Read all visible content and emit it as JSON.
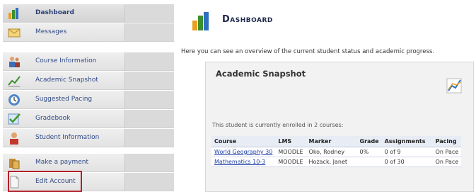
{
  "sidebar": {
    "items": [
      {
        "label": "Dashboard",
        "icon": "chart-icon",
        "active": true
      },
      {
        "label": "Messages",
        "icon": "envelope-icon"
      },
      {
        "label": "Course Information",
        "icon": "people-icon"
      },
      {
        "label": "Academic Snapshot",
        "icon": "graph-icon"
      },
      {
        "label": "Suggested Pacing",
        "icon": "calendar-icon"
      },
      {
        "label": "Gradebook",
        "icon": "checkmark-icon"
      },
      {
        "label": "Student Information",
        "icon": "student-icon"
      },
      {
        "label": "Make a payment",
        "icon": "money-icon"
      },
      {
        "label": "Edit Account",
        "icon": "document-icon"
      }
    ]
  },
  "page": {
    "title": "Dashboard",
    "intro": "Here you can see an overview of the current student status and academic progress."
  },
  "snapshot": {
    "title": "Academic Snapshot",
    "enrolled_text": "This student is currently enrolled in 2 courses:",
    "columns": [
      "Course",
      "LMS",
      "Marker",
      "Grade",
      "Assignments",
      "Pacing"
    ],
    "rows": [
      {
        "course": "World Geography 30",
        "lms": "MOODLE",
        "marker": "Oko, Rodney",
        "grade": "0%",
        "assignments": "0 of 9",
        "pacing": "On Pace"
      },
      {
        "course": "Mathematics 10-3",
        "lms": "MOODLE",
        "marker": "Hozack, Janet",
        "grade": "",
        "assignments": "0 of 30",
        "pacing": "On Pace"
      }
    ]
  },
  "colors": {
    "link": "#1e40a8",
    "nav_label": "#2f4a86",
    "highlight": "#b3212b"
  }
}
